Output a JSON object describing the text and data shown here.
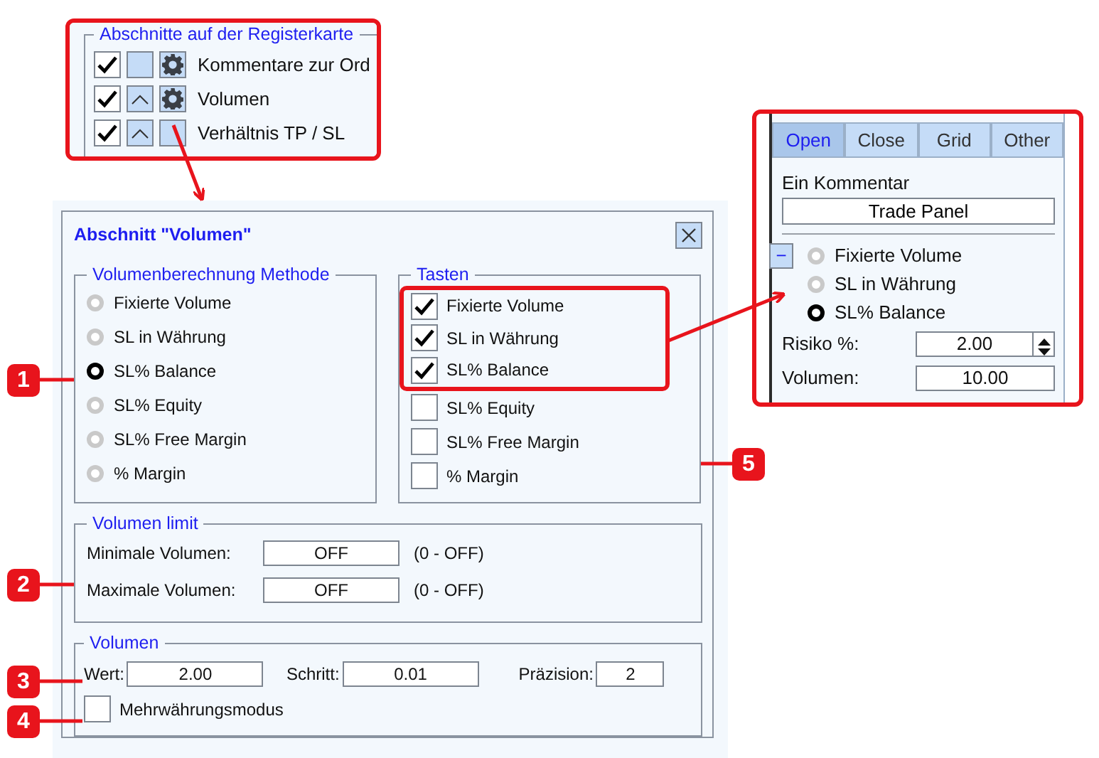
{
  "tab_sections_inset": {
    "title": "Abschnitte auf der Registerkarte",
    "rows": [
      {
        "checked": true,
        "move_up": false,
        "settings": true,
        "label": "Kommentare zur Ord"
      },
      {
        "checked": true,
        "move_up": true,
        "settings": true,
        "label": "Volumen"
      },
      {
        "checked": true,
        "move_up": true,
        "settings": false,
        "label": "Verhältnis TP / SL"
      }
    ]
  },
  "dialog": {
    "title": "Abschnitt \"Volumen\"",
    "method_group": {
      "title": "Volumenberechnung Methode",
      "options": [
        {
          "label": "Fixierte Volume",
          "selected": false
        },
        {
          "label": "SL in Währung",
          "selected": false
        },
        {
          "label": "SL% Balance",
          "selected": true
        },
        {
          "label": "SL% Equity",
          "selected": false
        },
        {
          "label": "SL% Free Margin",
          "selected": false
        },
        {
          "label": "% Margin",
          "selected": false
        }
      ]
    },
    "buttons_group": {
      "title": "Tasten",
      "options": [
        {
          "label": "Fixierte Volume",
          "checked": true
        },
        {
          "label": "SL in Währung",
          "checked": true
        },
        {
          "label": "SL% Balance",
          "checked": true
        },
        {
          "label": "SL% Equity",
          "checked": false
        },
        {
          "label": "SL% Free Margin",
          "checked": false
        },
        {
          "label": "% Margin",
          "checked": false
        }
      ]
    },
    "limit_group": {
      "title": "Volumen limit",
      "rows": [
        {
          "label": "Minimale Volumen:",
          "value": "OFF",
          "hint": "(0 - OFF)"
        },
        {
          "label": "Maximale Volumen:",
          "value": "OFF",
          "hint": "(0 - OFF)"
        }
      ]
    },
    "volume_group": {
      "title": "Volumen",
      "fields": [
        {
          "label": "Wert:",
          "value": "2.00"
        },
        {
          "label": "Schritt:",
          "value": "0.01"
        },
        {
          "label": "Präzision:",
          "value": "2"
        }
      ],
      "multi_currency": {
        "label": "Mehrwährungsmodus",
        "checked": false
      }
    }
  },
  "callouts": [
    "1",
    "2",
    "3",
    "4",
    "5"
  ],
  "panel_inset": {
    "tabs": [
      {
        "label": "Open",
        "selected": true
      },
      {
        "label": "Close",
        "selected": false
      },
      {
        "label": "Grid",
        "selected": false
      },
      {
        "label": "Other",
        "selected": false
      }
    ],
    "comment": "Ein Kommentar",
    "button": "Trade Panel",
    "collapse": "−",
    "options": [
      {
        "label": "Fixierte Volume",
        "selected": false
      },
      {
        "label": "SL in Währung",
        "selected": false
      },
      {
        "label": "SL% Balance",
        "selected": true
      }
    ],
    "fields": [
      {
        "label": "Risiko %:",
        "value": "2.00",
        "kind": "spinner"
      },
      {
        "label": "Volumen:",
        "value": "10.00",
        "kind": "plain"
      }
    ]
  }
}
